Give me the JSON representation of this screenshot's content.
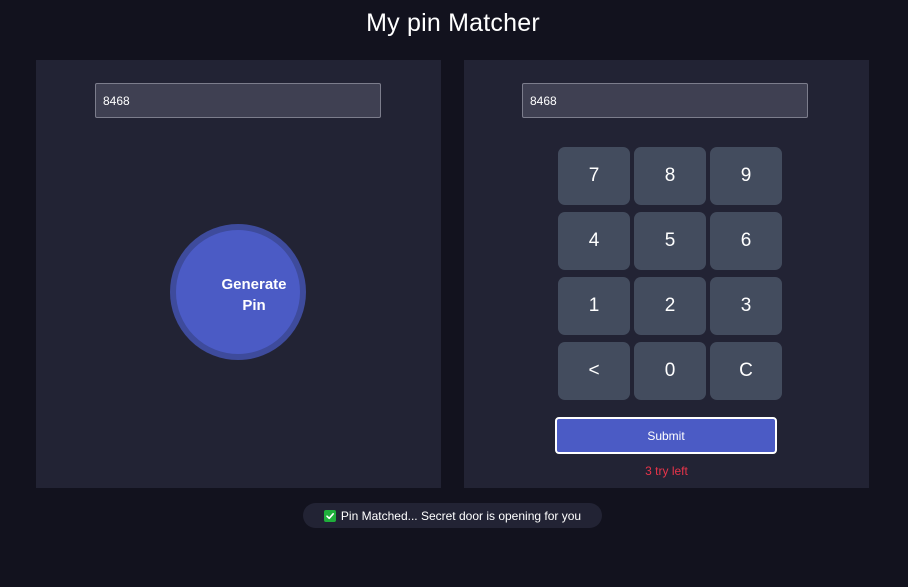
{
  "app": {
    "title": "My pin Matcher"
  },
  "generator": {
    "pin_value": "8468",
    "button_label": "Generate Pin"
  },
  "matcher": {
    "pin_value": "8468",
    "keys": [
      "7",
      "8",
      "9",
      "4",
      "5",
      "6",
      "1",
      "2",
      "3",
      "<",
      "0",
      "C"
    ],
    "submit_label": "Submit",
    "tries_left": "3 try left"
  },
  "notification": {
    "icon": "check-icon",
    "message": "Pin Matched... Secret door is opening for you"
  },
  "colors": {
    "background": "#12121e",
    "panel": "#222334",
    "accent": "#4b5bc5",
    "key": "#434c5e",
    "error": "#e8344a",
    "success": "#1fae3b"
  }
}
